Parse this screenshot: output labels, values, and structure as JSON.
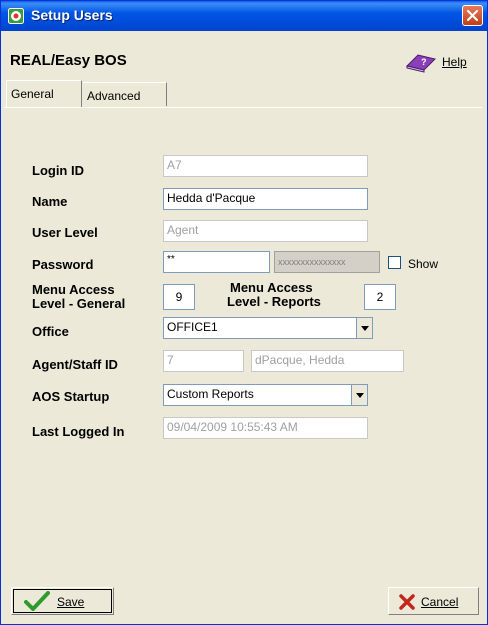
{
  "window": {
    "title": "Setup Users",
    "app_title": "REAL/Easy BOS",
    "title_icon": "bos-app-icon"
  },
  "header": {
    "help_label": "Help"
  },
  "tabs": [
    {
      "label": "General",
      "selected": true
    },
    {
      "label": "Advanced",
      "selected": false
    }
  ],
  "form": {
    "login_id": {
      "label": "Login ID",
      "value": "A7"
    },
    "name": {
      "label": "Name",
      "value": "Hedda d'Pacque"
    },
    "user_level": {
      "label": "User Level",
      "value": "Agent"
    },
    "password": {
      "label": "Password",
      "value": "**",
      "masked": "xxxxxxxxxxxxxxx",
      "show_label": "Show",
      "show_checked": false
    },
    "menu_access_general": {
      "label_line1": "Menu Access",
      "label_line2": "Level - General",
      "value": "9"
    },
    "menu_access_reports": {
      "label_line1": "Menu Access",
      "label_line2": "Level - Reports",
      "value": "2"
    },
    "office": {
      "label": "Office",
      "value": "OFFICE1"
    },
    "agent_staff_id": {
      "label": "Agent/Staff ID",
      "id_value": "7",
      "name_value": "dPacque, Hedda"
    },
    "aos_startup": {
      "label": "AOS Startup",
      "value": "Custom Reports"
    },
    "last_logged_in": {
      "label": "Last Logged In",
      "value": "09/04/2009 10:55:43 AM"
    }
  },
  "footer": {
    "save_label": "Save",
    "cancel_label": "Cancel"
  },
  "colors": {
    "titlebar": "#0055E5",
    "dialog_bg": "#ECE9D8",
    "close": "#C13E18",
    "save_check": "#2E9B2E",
    "cancel_x": "#C0281E"
  }
}
